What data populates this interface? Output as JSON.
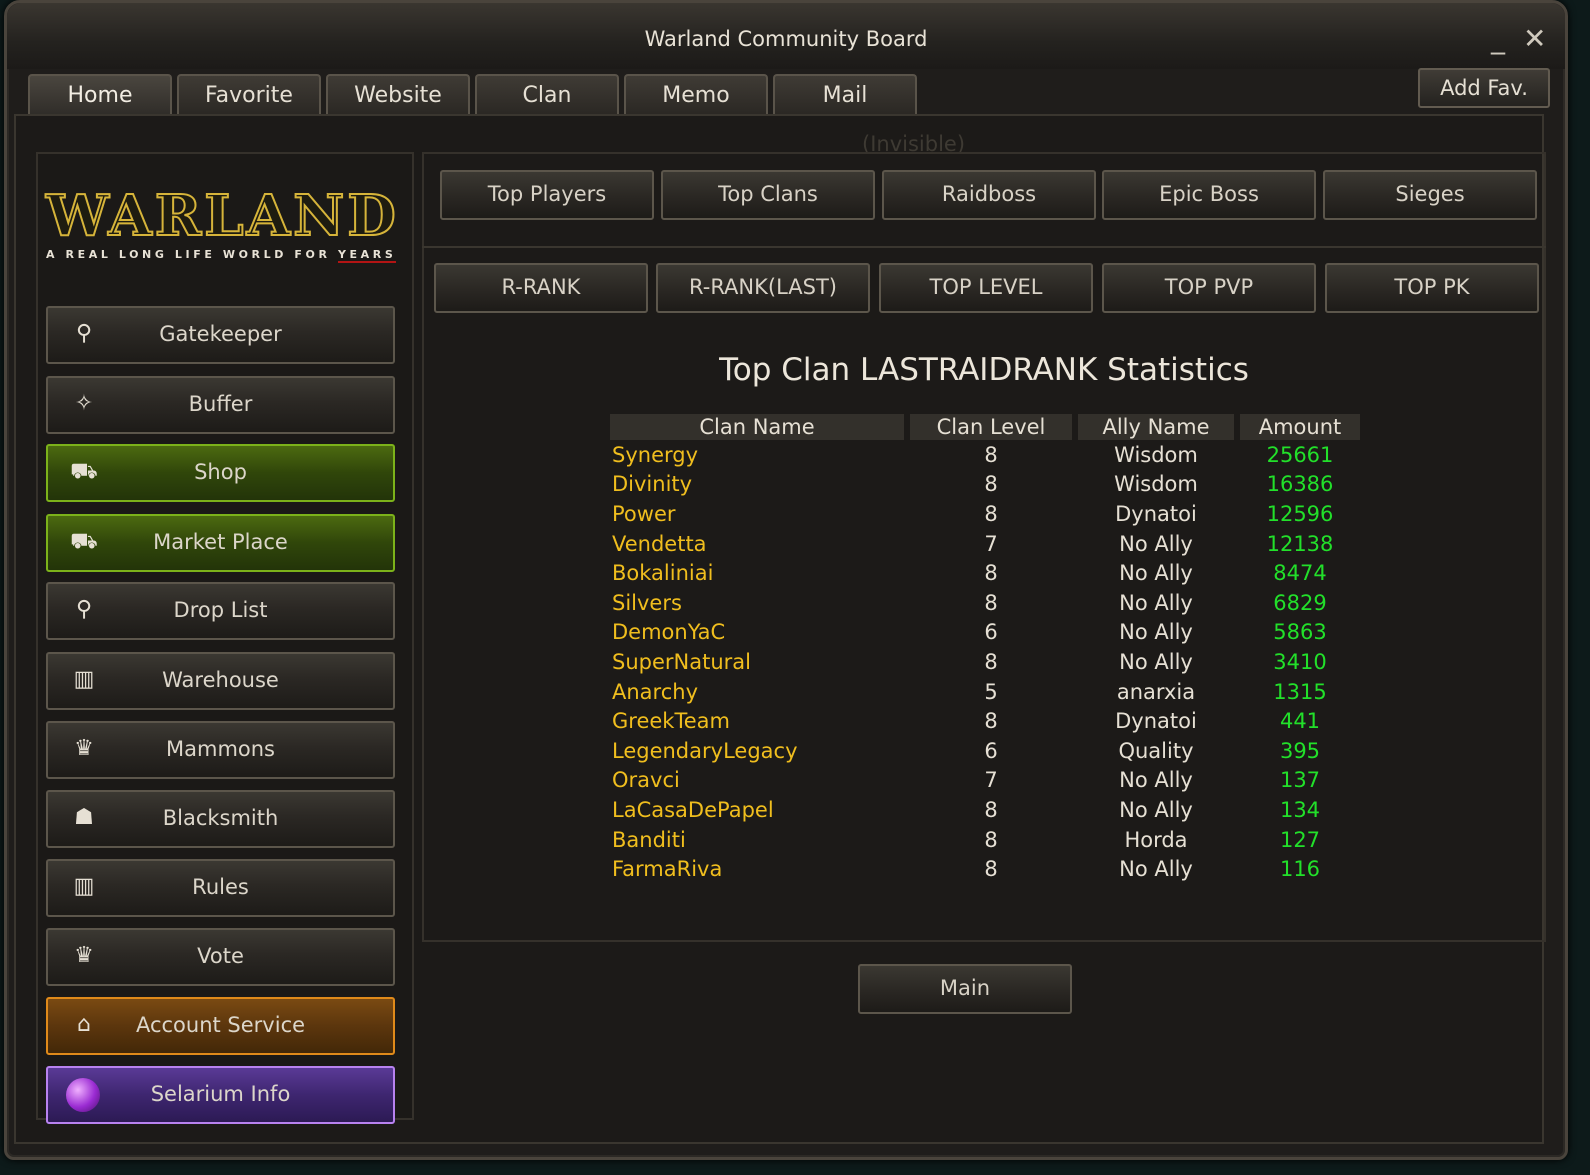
{
  "window": {
    "title": "Warland Community Board",
    "minimize": "_",
    "close": "✕"
  },
  "tabs": [
    {
      "label": "Home",
      "active": true
    },
    {
      "label": "Favorite"
    },
    {
      "label": "Website"
    },
    {
      "label": "Clan"
    },
    {
      "label": "Memo"
    },
    {
      "label": "Mail"
    }
  ],
  "add_fav": "Add Fav.",
  "invisible_label": "(Invisible)",
  "logo": {
    "title": "WARLAND",
    "tagline": "A REAL LONG LIFE WORLD FOR",
    "tagline_end": "YEARS"
  },
  "sidebar": [
    {
      "label": "Gatekeeper",
      "icon": "map-pin-icon",
      "glyph": "⚲",
      "style": "default"
    },
    {
      "label": "Buffer",
      "icon": "magic-wand-icon",
      "glyph": "✧",
      "style": "default"
    },
    {
      "label": "Shop",
      "icon": "basket-icon",
      "glyph": "⛟",
      "style": "green"
    },
    {
      "label": "Market Place",
      "icon": "basket-icon",
      "glyph": "⛟",
      "style": "green"
    },
    {
      "label": "Drop List",
      "icon": "map-pin-icon",
      "glyph": "⚲",
      "style": "default"
    },
    {
      "label": "Warehouse",
      "icon": "bar-chart-icon",
      "glyph": "▥",
      "style": "default"
    },
    {
      "label": "Mammons",
      "icon": "crown-icon",
      "glyph": "♛",
      "style": "default"
    },
    {
      "label": "Blacksmith",
      "icon": "user-icon",
      "glyph": "☗",
      "style": "default"
    },
    {
      "label": "Rules",
      "icon": "bar-chart-icon",
      "glyph": "▥",
      "style": "default"
    },
    {
      "label": "Vote",
      "icon": "crown-icon",
      "glyph": "♛",
      "style": "default"
    },
    {
      "label": "Account Service",
      "icon": "storefront-icon",
      "glyph": "⌂",
      "style": "orange"
    },
    {
      "label": "Selarium Info",
      "icon": "gem-icon",
      "glyph": "",
      "style": "purple"
    }
  ],
  "top_nav": [
    "Top Players",
    "Top Clans",
    "Raidboss",
    "Epic Boss",
    "Sieges"
  ],
  "sub_nav": [
    "R-RANK",
    "R-RANK(LAST)",
    "TOP LEVEL",
    "TOP PVP",
    "TOP PK"
  ],
  "stats": {
    "title": "Top Clan LASTRAIDRANK Statistics",
    "columns": [
      "Clan Name",
      "Clan Level",
      "Ally Name",
      "Amount"
    ],
    "rows": [
      [
        "Synergy",
        "8",
        "Wisdom",
        "25661"
      ],
      [
        "Divinity",
        "8",
        "Wisdom",
        "16386"
      ],
      [
        "Power",
        "8",
        "Dynatoi",
        "12596"
      ],
      [
        "Vendetta",
        "7",
        "No Ally",
        "12138"
      ],
      [
        "Bokaliniai",
        "8",
        "No Ally",
        "8474"
      ],
      [
        "Silvers",
        "8",
        "No Ally",
        "6829"
      ],
      [
        "DemonYaC",
        "6",
        "No Ally",
        "5863"
      ],
      [
        "SuperNatural",
        "8",
        "No Ally",
        "3410"
      ],
      [
        "Anarchy",
        "5",
        "anarxia",
        "1315"
      ],
      [
        "GreekTeam",
        "8",
        "Dynatoi",
        "441"
      ],
      [
        "LegendaryLegacy",
        "6",
        "Quality",
        "395"
      ],
      [
        "Oravci",
        "7",
        "No Ally",
        "137"
      ],
      [
        "LaCasaDePapel",
        "8",
        "No Ally",
        "134"
      ],
      [
        "Banditi",
        "8",
        "Horda",
        "127"
      ],
      [
        "FarmaRiva",
        "8",
        "No Ally",
        "116"
      ]
    ]
  },
  "main_button": "Main",
  "colors": {
    "clan_name": "#f0be1e",
    "amount": "#22e02a",
    "text": "#e6e0d4"
  }
}
